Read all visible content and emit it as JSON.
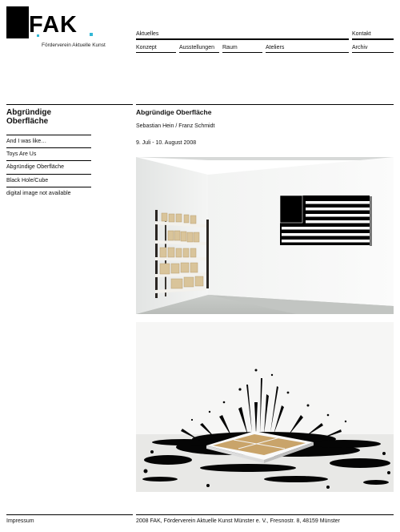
{
  "brand": {
    "logo_text": "FAK",
    "subtitle": "Förderverein Aktuelle Kunst",
    "accent_color": "#33b8d6"
  },
  "nav": {
    "row1": [
      "Aktuelles",
      "Kontakt"
    ],
    "row2": [
      "Konzept",
      "Ausstellungen",
      "Raum",
      "Ateliers",
      "Archiv"
    ]
  },
  "sidebar": {
    "title_line1": "Abgründige",
    "title_line2": "Oberfläche",
    "items": [
      "And I was like…",
      "Toys Are Us",
      "Abgründige Oberfläche",
      "Black Hole/Cube",
      "digital image not available"
    ]
  },
  "main": {
    "title": "Abgründige Oberfläche",
    "artists": "Sebastian Hein / Franz Schmidt",
    "dates": "9. Juli - 10. August 2008"
  },
  "footer": {
    "left": "Impressum",
    "right": "2008 FAK, Förderverein Aktuelle Kunst Münster e. V., Fresnostr. 8, 48159 Münster"
  }
}
